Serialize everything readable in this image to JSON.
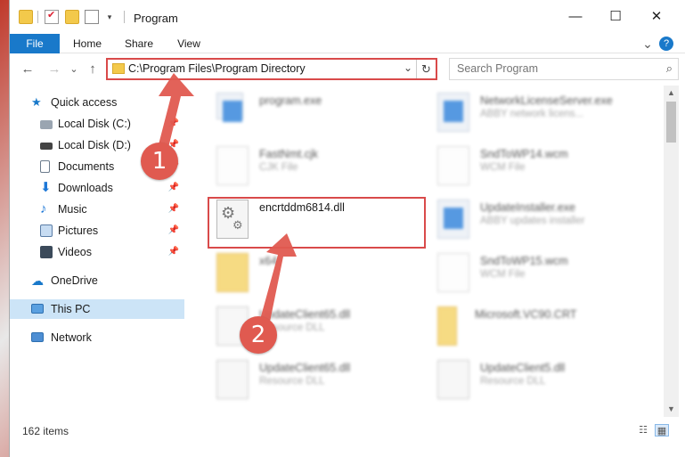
{
  "window": {
    "title": "Program",
    "minimize": "—",
    "maximize": "☐",
    "close": "✕"
  },
  "ribbon": {
    "tabs": [
      "File",
      "Home",
      "Share",
      "View"
    ],
    "expand": "⌄",
    "help": "?"
  },
  "nav": {
    "back": "←",
    "forward": "→",
    "recent": "⌄",
    "up": "↑",
    "address": "C:\\Program Files\\Program Directory",
    "refresh": "↻",
    "search_placeholder": "Search Program",
    "search_icon": "magnifier-icon"
  },
  "sidebar": {
    "items": [
      {
        "label": "Quick access",
        "icon": "star-icon",
        "pinned": false
      },
      {
        "label": "Local Disk (C:)",
        "icon": "drive-icon",
        "pinned": true
      },
      {
        "label": "Local Disk (D:)",
        "icon": "drive-icon",
        "pinned": true
      },
      {
        "label": "Documents",
        "icon": "documents-icon",
        "pinned": true
      },
      {
        "label": "Downloads",
        "icon": "download-icon",
        "pinned": true
      },
      {
        "label": "Music",
        "icon": "music-icon",
        "pinned": true
      },
      {
        "label": "Pictures",
        "icon": "pictures-icon",
        "pinned": true
      },
      {
        "label": "Videos",
        "icon": "videos-icon",
        "pinned": true
      },
      {
        "label": "OneDrive",
        "icon": "cloud-icon",
        "pinned": false
      },
      {
        "label": "This PC",
        "icon": "computer-icon",
        "pinned": false,
        "selected": true
      },
      {
        "label": "Network",
        "icon": "network-icon",
        "pinned": false
      }
    ]
  },
  "files": [
    {
      "name": "program.exe",
      "type": ""
    },
    {
      "name": "NetworkLicenseServer.exe",
      "type": "ABBY network licens..."
    },
    {
      "name": "FastNmt.cjk",
      "type": "CJK File"
    },
    {
      "name": "SndToWP14.wcm",
      "type": "WCM File"
    },
    {
      "name": "encrtddm6814.dll",
      "type": ""
    },
    {
      "name": "UpdateInstaller.exe",
      "type": "ABBY updates installer"
    },
    {
      "name": "x64",
      "type": ""
    },
    {
      "name": "SndToWP15.wcm",
      "type": "WCM File"
    },
    {
      "name": "UpdateClient65.dll",
      "type": "Resource DLL"
    },
    {
      "name": "Microsoft.VC90.CRT",
      "type": ""
    },
    {
      "name": "UpdateClient65.dll",
      "type": "Resource DLL"
    },
    {
      "name": "UpdateClient5.dll",
      "type": "Resource DLL"
    }
  ],
  "status": {
    "count": "162 items"
  },
  "annotations": {
    "step1": "1",
    "step2": "2",
    "color": "#e05a50"
  }
}
